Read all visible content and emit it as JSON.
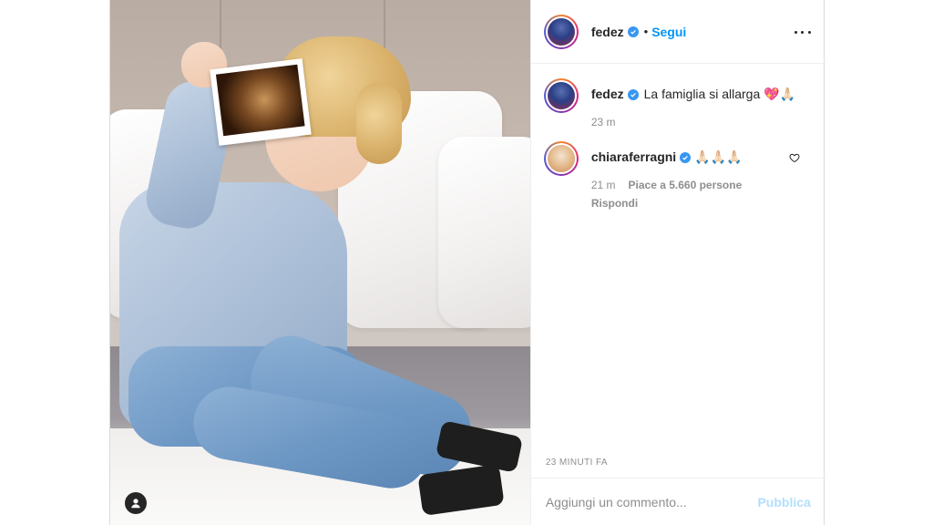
{
  "post": {
    "author": {
      "username": "fedez",
      "verified": true,
      "follow_label": "Segui",
      "separator": "•"
    },
    "caption": {
      "username": "fedez",
      "text": "La famiglia si allarga",
      "emoji": "💖🙏🏻",
      "time": "23 m"
    },
    "comments": [
      {
        "username": "chiaraferragni",
        "verified": true,
        "text": "🙏🏻🙏🏻🙏🏻",
        "time": "21 m",
        "likes": "Piace a 5.660 persone",
        "reply_label": "Rispondi"
      }
    ],
    "timestamp": "23 MINUTI FA",
    "comment_box": {
      "placeholder": "Aggiungi un commento...",
      "publish_label": "Pubblica"
    }
  },
  "icons": {
    "verified": "verified-badge-icon",
    "more": "more-options-icon",
    "heart": "heart-icon",
    "user": "user-tag-icon"
  },
  "colors": {
    "accent": "#0095f6",
    "verified": "#3897f0",
    "muted": "#8e8e8e",
    "publish_disabled": "#b2dffc"
  }
}
